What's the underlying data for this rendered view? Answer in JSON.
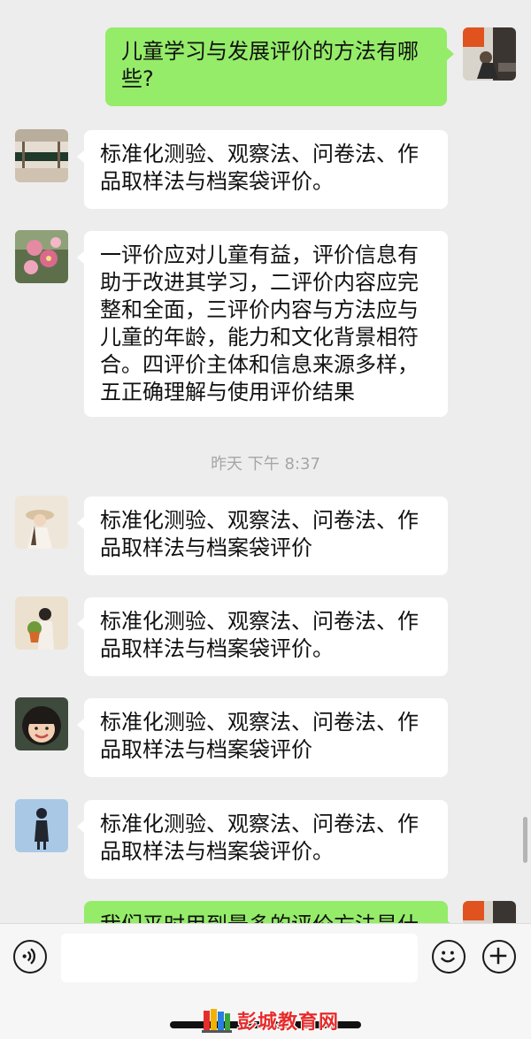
{
  "messages": [
    {
      "side": "out",
      "text": "儿童学习与发展评价的方法有哪些?",
      "avatar": "user-avatar-photo"
    },
    {
      "side": "in",
      "text": "标准化测验、观察法、问卷法、作品取样法与档案袋评价。",
      "avatar": "building-avatar-photo"
    },
    {
      "side": "in",
      "text": "一评价应对儿童有益，评价信息有助于改进其学习，二评价内容应完整和全面，三评价内容与方法应与儿童的年龄，能力和文化背景相符合。四评价主体和信息来源多样，五正确理解与使用评价结果",
      "avatar": "flower-avatar-photo"
    },
    {
      "side": "in",
      "text": "标准化测验、观察法、问卷法、作品取样法与档案袋评价",
      "avatar": "girl-hat-avatar-photo"
    },
    {
      "side": "in",
      "text": "标准化测验、观察法、问卷法、作品取样法与档案袋评价。",
      "avatar": "illustrated-girl-avatar"
    },
    {
      "side": "in",
      "text": "标准化测验、观察法、问卷法、作品取样法与档案袋评价",
      "avatar": "child-avatar-photo"
    },
    {
      "side": "in",
      "text": "标准化测验、观察法、问卷法、作品取样法与档案袋评价。",
      "avatar": "cartoon-figure-avatar"
    },
    {
      "side": "out",
      "text": "我们平时用到最多的评价方法是什",
      "avatar": "user-avatar-photo"
    }
  ],
  "timestamp": "昨天 下午 8:37",
  "input_bar": {
    "voice_icon": "voice-icon",
    "emoji_icon": "emoji-icon",
    "plus_icon": "plus-icon",
    "text_value": ""
  },
  "watermark": {
    "text": "彭城教育网",
    "logo": "books-logo"
  },
  "colors": {
    "background": "#ededed",
    "incoming_bubble": "#ffffff",
    "outgoing_bubble": "#95ec69",
    "timestamp": "#a6a6a6",
    "watermark": "#e62d2d"
  }
}
